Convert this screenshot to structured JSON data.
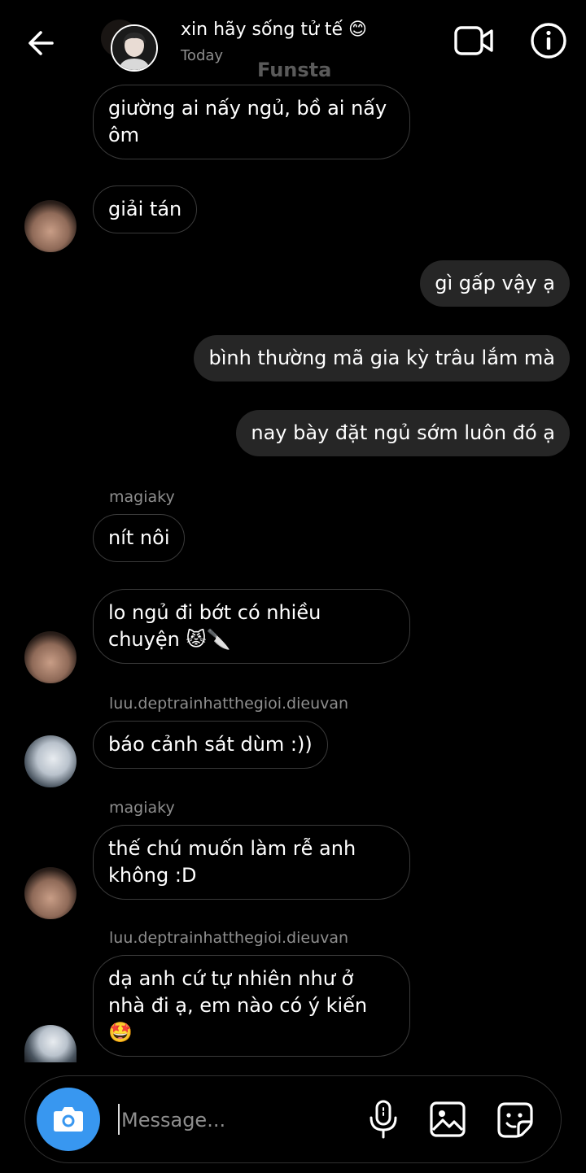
{
  "header": {
    "title": "xin hãy sống tử tế 😊",
    "subtitle": "Today",
    "watermark": "Funsta",
    "icons": [
      "back-arrow-icon",
      "video-call-icon",
      "info-icon"
    ]
  },
  "messages": [
    {
      "type": "incoming",
      "text": "giường ai nấy ngủ, bồ ai nấy ôm"
    },
    {
      "type": "incoming",
      "text": "giải tán"
    },
    {
      "type": "outgoing",
      "text": "gì gấp vậy ạ"
    },
    {
      "type": "outgoing",
      "text": "bình thường mã gia kỳ trâu lắm mà"
    },
    {
      "type": "outgoing",
      "text": "nay bày đặt ngủ sớm luôn đó ạ"
    },
    {
      "type": "incoming",
      "sender": "magiaky",
      "text": "nít nôi"
    },
    {
      "type": "incoming",
      "text": "lo ngủ đi bớt có nhiều chuyện 😾🔪"
    },
    {
      "type": "incoming",
      "sender": "luu.deptrainhatthegioi.dieuvan",
      "text": "báo cảnh sát dùm :))"
    },
    {
      "type": "incoming",
      "sender": "magiaky",
      "text": "thế chú muốn làm rễ anh không :D"
    },
    {
      "type": "incoming",
      "sender": "luu.deptrainhatthegioi.dieuvan",
      "text": "dạ anh cứ tự nhiên như ở nhà đi ạ, em nào có ý kiến 🤩"
    }
  ],
  "composer": {
    "placeholder": "Message...",
    "icons": [
      "camera-icon",
      "microphone-icon",
      "gallery-icon",
      "sticker-icon"
    ],
    "camera_color": "#3897f0"
  }
}
